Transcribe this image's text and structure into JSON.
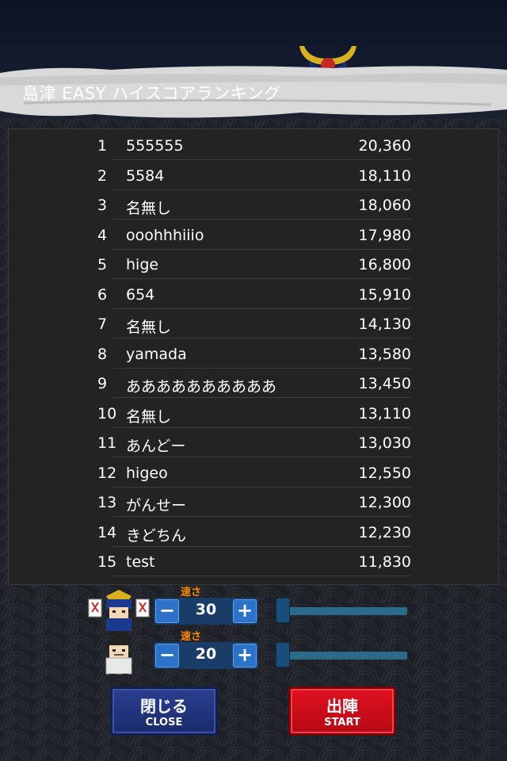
{
  "title": "島津 EASY ハイスコアランキング",
  "ranking": [
    {
      "rank": "1",
      "name": "555555",
      "score": "20,360"
    },
    {
      "rank": "2",
      "name": "5584",
      "score": "18,110"
    },
    {
      "rank": "3",
      "name": "名無し",
      "score": "18,060"
    },
    {
      "rank": "4",
      "name": "ooohhhiiio",
      "score": "17,980"
    },
    {
      "rank": "5",
      "name": "hige",
      "score": "16,800"
    },
    {
      "rank": "6",
      "name": "654",
      "score": "15,910"
    },
    {
      "rank": "7",
      "name": "名無し",
      "score": "14,130"
    },
    {
      "rank": "8",
      "name": "yamada",
      "score": "13,580"
    },
    {
      "rank": "9",
      "name": "ああああああああああ",
      "score": "13,450"
    },
    {
      "rank": "10",
      "name": "名無し",
      "score": "13,110"
    },
    {
      "rank": "11",
      "name": "あんどー",
      "score": "13,030"
    },
    {
      "rank": "12",
      "name": "higeo",
      "score": "12,550"
    },
    {
      "rank": "13",
      "name": "がんせー",
      "score": "12,300"
    },
    {
      "rank": "14",
      "name": "きどちん",
      "score": "12,230"
    },
    {
      "rank": "15",
      "name": "test",
      "score": "11,830"
    }
  ],
  "controls": {
    "player1": {
      "speed_label": "速さ",
      "value": "30",
      "avatar": "samurai-avatar-icon",
      "slider_level": 0.05
    },
    "player2": {
      "speed_label": "速さ",
      "value": "20",
      "avatar": "ninja-avatar-icon",
      "slider_level": 0.05
    },
    "minus_symbol": "−",
    "plus_symbol": "+"
  },
  "buttons": {
    "close_main": "閉じる",
    "close_sub": "CLOSE",
    "start_main": "出陣",
    "start_sub": "START"
  },
  "colors": {
    "close_button": "#2a3f8f",
    "start_button": "#e0101e",
    "speed_label": "#ff8a00"
  }
}
